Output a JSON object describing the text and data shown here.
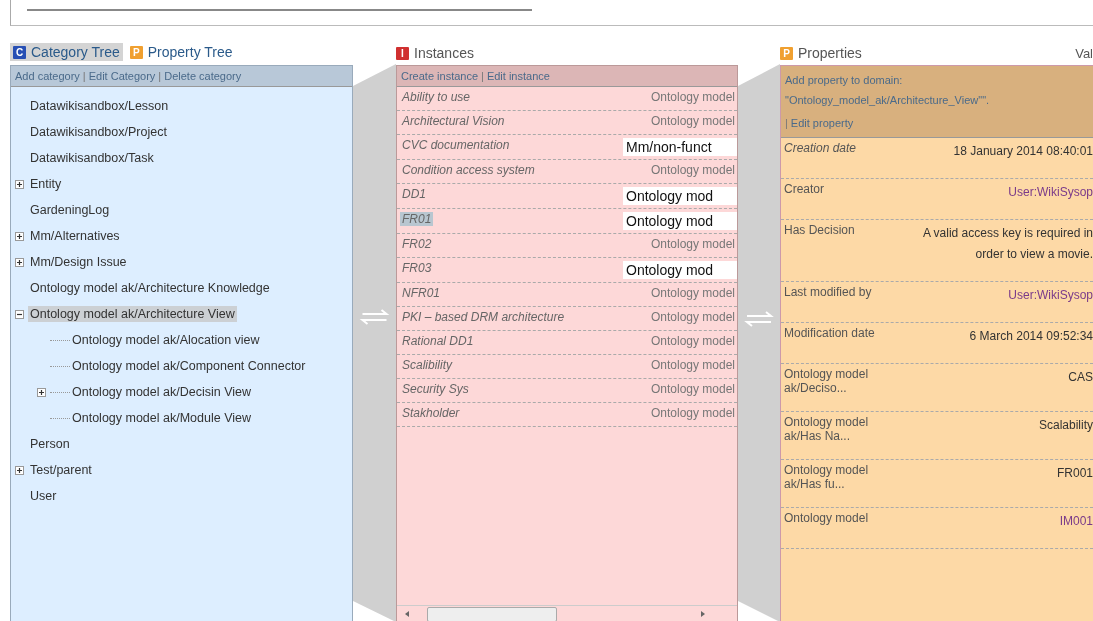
{
  "tree_panel": {
    "tabs": [
      {
        "icon": "C",
        "color": "#2850b4",
        "label": "Category Tree",
        "selected": true
      },
      {
        "icon": "P",
        "color": "#f0a030",
        "label": "Property Tree",
        "selected": false
      }
    ],
    "separator": "|",
    "actions": [
      "Add category",
      "Edit Category",
      "Delete category"
    ],
    "items": [
      {
        "label": "Datawikisandbox/Lesson",
        "expandable": false,
        "expanded": false,
        "selected": false
      },
      {
        "label": "Datawikisandbox/Project",
        "expandable": false,
        "expanded": false,
        "selected": false
      },
      {
        "label": "Datawikisandbox/Task",
        "expandable": false,
        "expanded": false,
        "selected": false
      },
      {
        "label": "Entity",
        "expandable": true,
        "expanded": false,
        "selected": false
      },
      {
        "label": "GardeningLog",
        "expandable": false,
        "expanded": false,
        "selected": false
      },
      {
        "label": "Mm/Alternatives",
        "expandable": true,
        "expanded": false,
        "selected": false
      },
      {
        "label": "Mm/Design Issue",
        "expandable": true,
        "expanded": false,
        "selected": false
      },
      {
        "label": "Ontology model ak/Architecture Knowledge",
        "expandable": false,
        "expanded": false,
        "selected": false
      },
      {
        "label": "Ontology model ak/Architecture View",
        "expandable": true,
        "expanded": true,
        "selected": true,
        "children": [
          {
            "label": "Ontology model ak/Alocation view",
            "expandable": false,
            "expanded": false,
            "selected": false
          },
          {
            "label": "Ontology model ak/Component Connector",
            "expandable": false,
            "expanded": false,
            "selected": false
          },
          {
            "label": "Ontology model ak/Decisin View",
            "expandable": true,
            "expanded": false,
            "selected": false
          },
          {
            "label": "Ontology model ak/Module View",
            "expandable": false,
            "expanded": false,
            "selected": false
          }
        ]
      },
      {
        "label": "Person",
        "expandable": false,
        "expanded": false,
        "selected": false
      },
      {
        "label": "Test/parent",
        "expandable": true,
        "expanded": false,
        "selected": false
      },
      {
        "label": "User",
        "expandable": false,
        "expanded": false,
        "selected": false
      }
    ]
  },
  "instances_panel": {
    "icon": "I",
    "color": "#d03030",
    "title": "Instances",
    "separator": "|",
    "actions": [
      "Create instance",
      "Edit instance"
    ],
    "rows": [
      {
        "name": "Ability to use",
        "value": "Ontology model",
        "kind": "text",
        "selected": false
      },
      {
        "name": "Architectural Vision",
        "value": "Ontology model",
        "kind": "text",
        "selected": false
      },
      {
        "name": "CVC documentation",
        "value": "Mm/non-funct",
        "kind": "box",
        "selected": false
      },
      {
        "name": "Condition access system",
        "value": "Ontology model",
        "kind": "text",
        "selected": false
      },
      {
        "name": "DD1",
        "value": "Ontology mod",
        "kind": "box",
        "selected": false
      },
      {
        "name": "FR01",
        "value": "Ontology mod",
        "kind": "box",
        "selected": true
      },
      {
        "name": "FR02",
        "value": "Ontology model",
        "kind": "text",
        "selected": false
      },
      {
        "name": "FR03",
        "value": "Ontology mod",
        "kind": "box",
        "selected": false
      },
      {
        "name": "NFR01",
        "value": "Ontology model",
        "kind": "text",
        "selected": false
      },
      {
        "name": "PKI – based DRM architecture",
        "value": "Ontology model",
        "kind": "text",
        "selected": false
      },
      {
        "name": "Rational DD1",
        "value": "Ontology model",
        "kind": "text",
        "selected": false
      },
      {
        "name": "Scalibility",
        "value": "Ontology model",
        "kind": "text",
        "selected": false
      },
      {
        "name": "Security Sys",
        "value": "Ontology model",
        "kind": "text",
        "selected": false
      },
      {
        "name": "Stakholder",
        "value": "Ontology model",
        "kind": "text",
        "selected": false
      }
    ]
  },
  "properties_panel": {
    "icon": "P",
    "color": "#f0a030",
    "title": "Properties",
    "column_2": "Val",
    "separator": "|",
    "actions": [
      "Add property to domain: \"Ontology_model_ak/Architecture_View\"\".",
      "Edit property"
    ],
    "rows": [
      {
        "label": "Creation date",
        "italic": true,
        "value": "18 January 2014 08:40:01",
        "kind": "text"
      },
      {
        "label": "Creator",
        "italic": false,
        "value": "User:WikiSysop",
        "kind": "link"
      },
      {
        "label": "Has Decision",
        "italic": false,
        "value": "A valid access key is required in order to view a movie.",
        "kind": "text"
      },
      {
        "label": "Last modified by",
        "italic": false,
        "value": "User:WikiSysop",
        "kind": "link"
      },
      {
        "label": "Modification date",
        "italic": false,
        "value": "6 March 2014 09:52:34",
        "kind": "text"
      },
      {
        "label": "Ontology model ak/Deciso...",
        "italic": false,
        "value": "CAS",
        "kind": "text"
      },
      {
        "label": "Ontology model ak/Has Na...",
        "italic": false,
        "value": "Scalability",
        "kind": "text"
      },
      {
        "label": "Ontology model ak/Has fu...",
        "italic": false,
        "value": "FR001",
        "kind": "text"
      },
      {
        "label": "Ontology model",
        "italic": false,
        "value": "IM001",
        "kind": "link"
      }
    ]
  }
}
